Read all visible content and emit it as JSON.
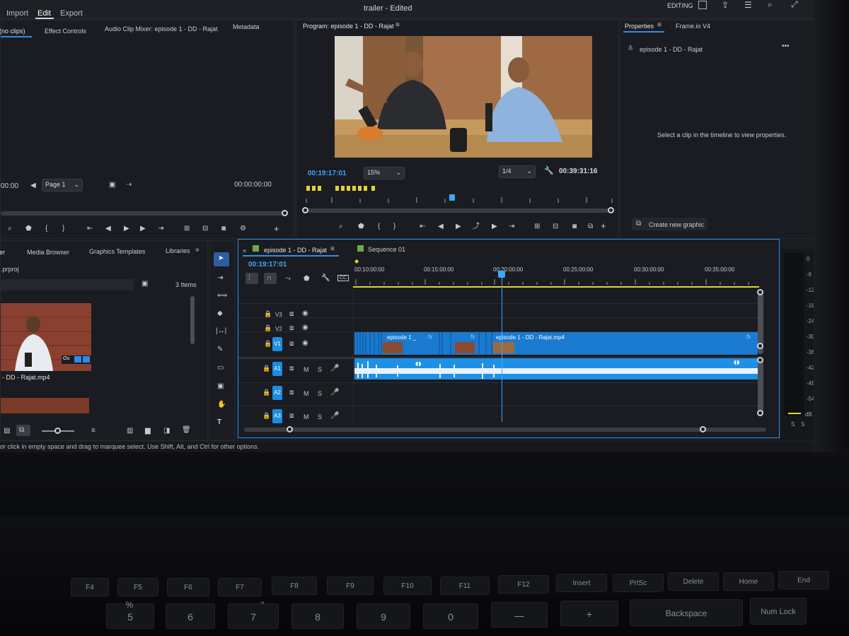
{
  "app": {
    "doc_title": "trailer - Edited",
    "workspace": "EDITING",
    "menu": [
      "Import",
      "Edit",
      "Export"
    ]
  },
  "source_panel": {
    "tabs": [
      "(no clips)",
      "Effect Controls",
      "Audio Clip Mixer: episode 1  - DD - Rajat",
      "Metadata"
    ],
    "timecode_left": "00:00",
    "page_dropdown": "Page 1",
    "timecode_right": "00:00:00:00"
  },
  "program_monitor": {
    "title": "Program: episode 1  - DD - Rajat",
    "current_tc": "00:19:17:01",
    "zoom": "15%",
    "resolution": "1/4",
    "duration": "00:39:31:16",
    "playhead_fraction": 0.49
  },
  "properties_panel": {
    "tabs": [
      "Properties",
      "Frame.io V4"
    ],
    "sequence_name": "episode 1  - DD - Rajat",
    "empty_message": "Select a clip in the timeline to view properties.",
    "create_graphic": "Create new graphic"
  },
  "project_panel": {
    "tabs": [
      "er",
      "Media Browser",
      "Graphics Templates",
      "Libraries"
    ],
    "project_file": ".prproj",
    "items_count": "3 Items",
    "clip_name": "- DD - Rajat.mp4",
    "clip_badge": "Ou"
  },
  "timeline": {
    "tabs": [
      "episode 1  - DD - Rajat",
      "Sequence 01"
    ],
    "current_tc": "00:19:17:01",
    "ruler": [
      "00:10:00:00",
      "00:15:00:00",
      "00:20:00:00",
      "00:25:00:00",
      "00:30:00:00",
      "00:35:00:00"
    ],
    "tracks": {
      "video": [
        {
          "name": "V3",
          "targeted": false
        },
        {
          "name": "V2",
          "targeted": false
        },
        {
          "name": "V1",
          "targeted": true
        }
      ],
      "audio": [
        {
          "name": "A1",
          "targeted": true
        },
        {
          "name": "A2",
          "targeted": true
        },
        {
          "name": "A3",
          "targeted": true
        }
      ],
      "audio_buttons": [
        "M",
        "S"
      ]
    },
    "clips": {
      "v1_left_label": "episode 1 _",
      "v1_right_label": "episode 1 - DD - Rajat.mp4",
      "fx": "fx"
    }
  },
  "audio_meter": {
    "scale": [
      "0",
      "-6",
      "-12",
      "-18",
      "-24",
      "-30",
      "-36",
      "-42",
      "-48",
      "-54",
      "dB"
    ],
    "solo": [
      "S",
      "S"
    ]
  },
  "status_bar": {
    "text": "or click in empty space and drag to marquee select. Use Shift, Alt, and Ctrl for other options."
  },
  "keyboard": {
    "fkeys": [
      "F4",
      "F5",
      "F6",
      "F7",
      "F8",
      "F9",
      "F10",
      "F11",
      "F12",
      "Insert",
      "PrtSc",
      "Delete",
      "Home",
      "End"
    ],
    "numrow": [
      "5",
      "%",
      "6",
      "&",
      "7",
      "8",
      "9",
      "0",
      "—",
      "+",
      "Backspace",
      "Num Lock"
    ]
  },
  "colors": {
    "accent": "#2d8ceb",
    "timecode": "#3ca7ff",
    "clip_video": "#1a7ad0",
    "clip_audio": "#1e90e6",
    "work_area": "#e3d23a",
    "panel_bg": "#1a1c21"
  }
}
